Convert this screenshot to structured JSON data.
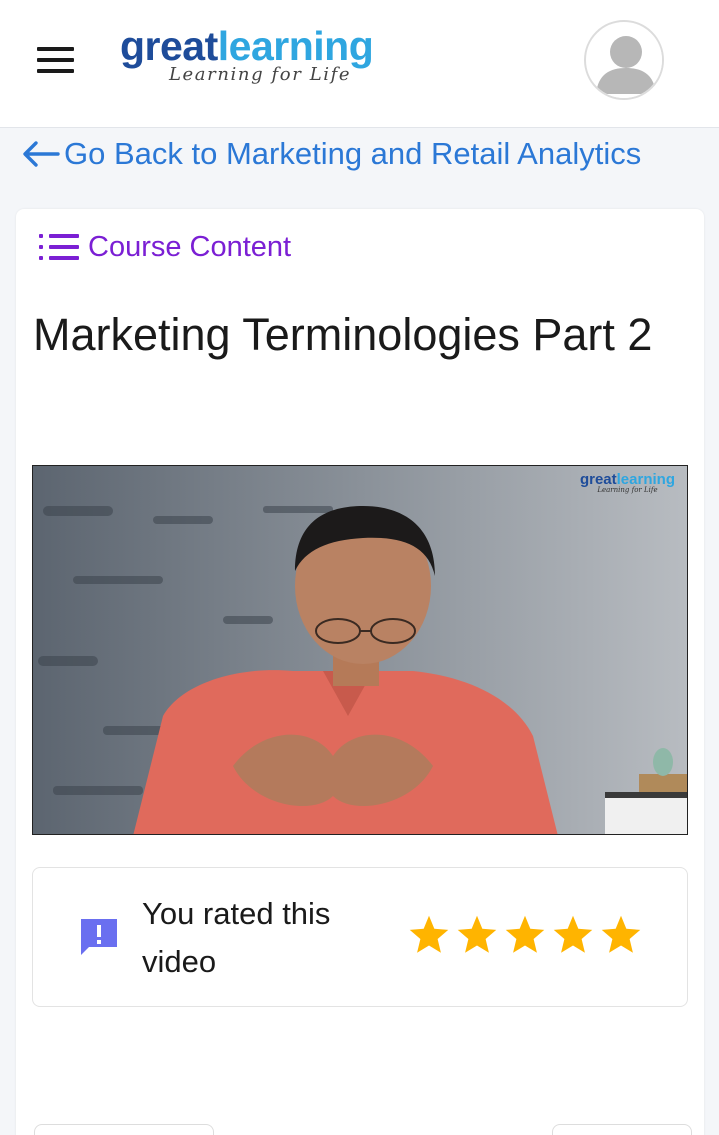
{
  "header": {
    "logo": {
      "great": "great",
      "learning": "learning",
      "tagline": "Learning for Life"
    }
  },
  "nav": {
    "back_label": "Go Back to Marketing and Retail Analytics"
  },
  "course": {
    "content_label": "Course Content",
    "video_title": "Marketing Terminologies Part 2"
  },
  "video": {
    "watermark": {
      "great": "great",
      "learning": "learning",
      "tagline": "Learning for Life"
    }
  },
  "rating": {
    "text": "You rated this video",
    "value": 5,
    "max": 5
  },
  "colors": {
    "brand_dark": "#1e4c9a",
    "brand_light": "#2fa6e0",
    "link": "#2b78d6",
    "accent_purple": "#7b1fd4",
    "star": "#ffb400",
    "feedback_icon": "#6a6ff0"
  }
}
